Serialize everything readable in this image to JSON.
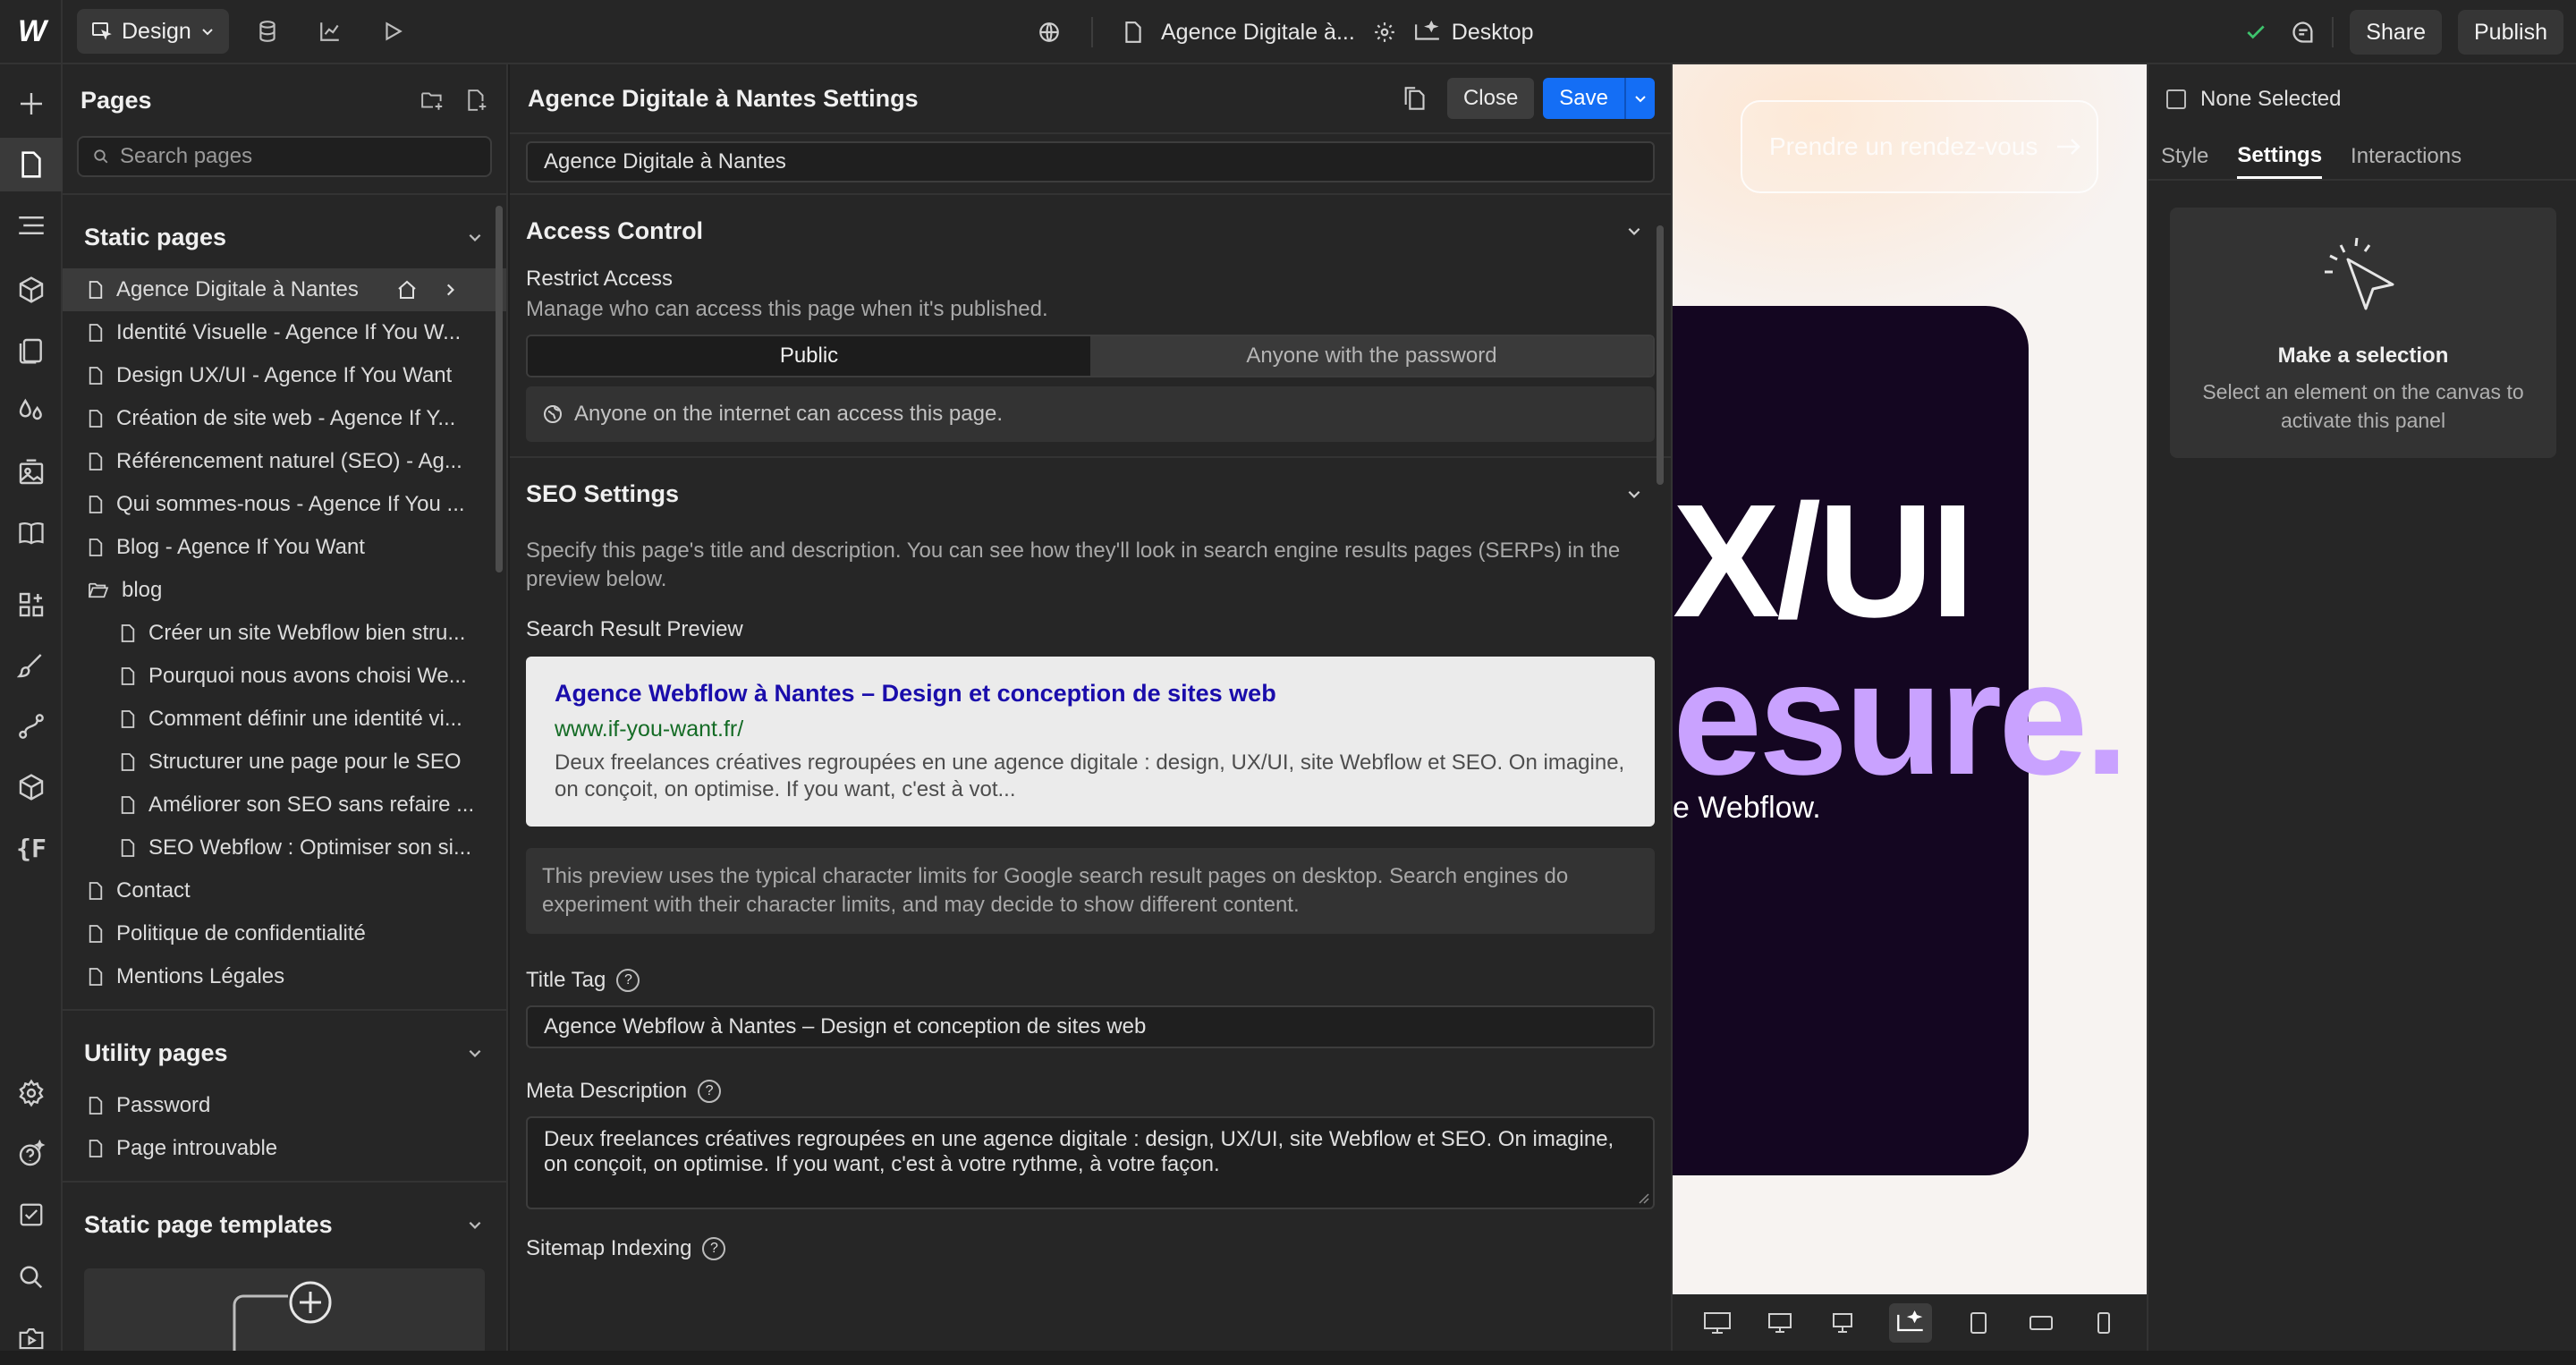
{
  "topbar": {
    "mode": "Design",
    "page_title": "Agence Digitale à...",
    "breakpoint": "Desktop",
    "share": "Share",
    "publish": "Publish"
  },
  "pages_panel": {
    "title": "Pages",
    "search_placeholder": "Search pages",
    "static_title": "Static pages",
    "static_pages": [
      "Agence Digitale à Nantes",
      "Identité Visuelle - Agence If You W...",
      "Design UX/UI - Agence If You Want",
      "Création de site web - Agence If Y...",
      "Référencement naturel (SEO) - Ag...",
      "Qui sommes-nous - Agence If You ...",
      "Blog - Agence If You Want"
    ],
    "folder": "blog",
    "blog_pages": [
      "Créer un site Webflow bien stru...",
      "Pourquoi nous avons choisi We...",
      "Comment définir une identité vi...",
      "Structurer une page pour le SEO",
      "Améliorer son SEO sans refaire ...",
      "SEO Webflow : Optimiser son si..."
    ],
    "more_pages": [
      "Contact",
      "Politique de confidentialité",
      "Mentions Légales"
    ],
    "utility_title": "Utility pages",
    "utility_pages": [
      "Password",
      "Page introuvable"
    ],
    "templates_title": "Static page templates"
  },
  "settings": {
    "title": "Agence Digitale à Nantes Settings",
    "close": "Close",
    "save": "Save",
    "page_name": "Agence Digitale à Nantes",
    "access": {
      "title": "Access Control",
      "label": "Restrict Access",
      "desc": "Manage who can access this page when it's published.",
      "opt_public": "Public",
      "opt_password": "Anyone with the password",
      "info": "Anyone on the internet can access this page."
    },
    "seo": {
      "title": "SEO Settings",
      "desc": "Specify this page's title and description. You can see how they'll look in search engine results pages (SERPs) in the preview below.",
      "preview_label": "Search Result Preview",
      "serp_title": "Agence Webflow à Nantes – Design et conception de sites web",
      "serp_url": "www.if-you-want.fr/",
      "serp_desc": "Deux freelances créatives regroupées en une agence digitale : design, UX/UI, site Webflow et SEO. On imagine, on conçoit, on optimise. If you want, c'est à vot...",
      "note": "This preview uses the typical character limits for Google search result pages on desktop. Search engines do experiment with their character limits, and may decide to show different content.",
      "title_tag_label": "Title Tag",
      "title_tag": "Agence Webflow à Nantes – Design et conception de sites web",
      "meta_label": "Meta Description",
      "meta": "Deux freelances créatives regroupées en une agence digitale : design, UX/UI, site Webflow et SEO. On imagine, on conçoit, on optimise. If you want, c'est à votre rythme, à votre façon.",
      "sitemap_label": "Sitemap Indexing"
    }
  },
  "canvas": {
    "cta": "Prendre un rendez-vous",
    "heading1": "X/UI",
    "heading2": "esure.",
    "sub": "e Webflow."
  },
  "right_panel": {
    "none_selected": "None Selected",
    "tabs": [
      "Style",
      "Settings",
      "Interactions"
    ],
    "card_title": "Make a selection",
    "card_desc": "Select an element on the canvas to activate this panel"
  }
}
